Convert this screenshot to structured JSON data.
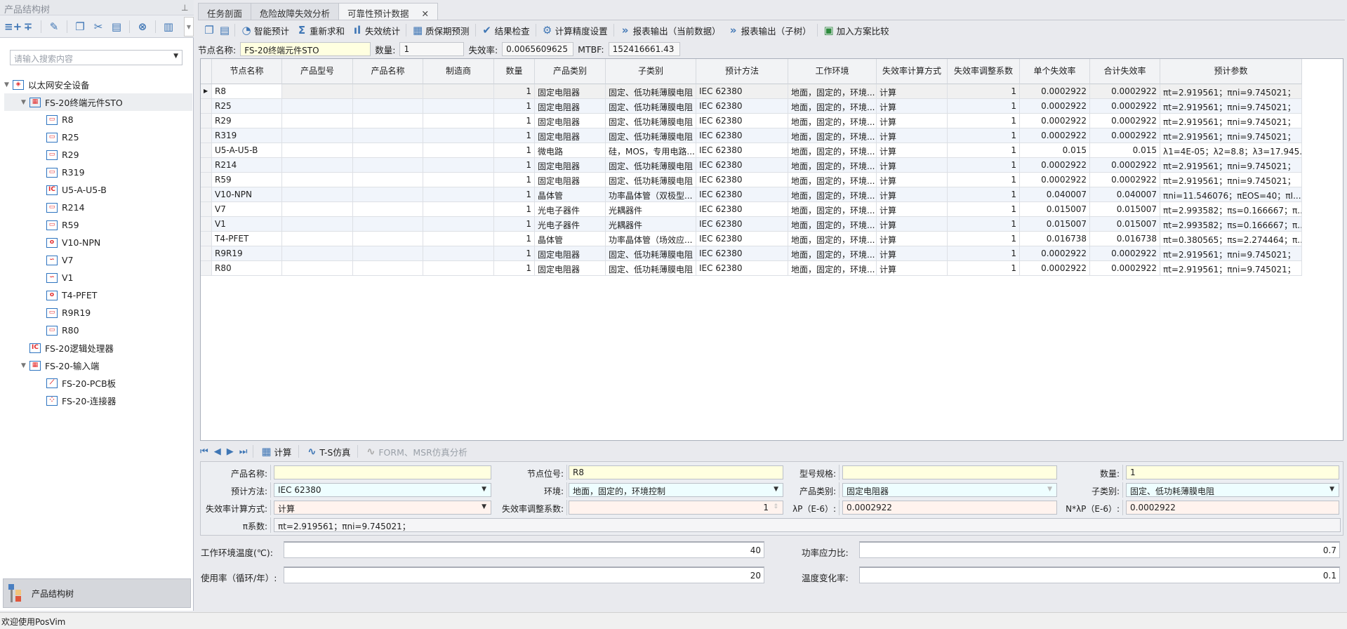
{
  "left_panel": {
    "title": "产品结构树",
    "search_placeholder": "请输入搜索内容",
    "bottom_button": "产品结构树",
    "toolbar_icons": [
      "add-child-icon",
      "add-sibling-icon",
      "edit-icon",
      "copy-icon",
      "cut-icon",
      "paste-icon",
      "delete-icon",
      "document-icon"
    ],
    "tree": [
      {
        "label": "以太网安全设备",
        "level": 0,
        "icon": "system-icon",
        "expanded": true
      },
      {
        "label": "FS-20终端元件STO",
        "level": 1,
        "icon": "assembly-icon",
        "expanded": true,
        "selected": true
      },
      {
        "label": "R8",
        "level": 2,
        "icon": "resistor-icon"
      },
      {
        "label": "R25",
        "level": 2,
        "icon": "resistor-icon"
      },
      {
        "label": "R29",
        "level": 2,
        "icon": "resistor-icon"
      },
      {
        "label": "R319",
        "level": 2,
        "icon": "resistor-icon"
      },
      {
        "label": "U5-A-U5-B",
        "level": 2,
        "icon": "ic-icon"
      },
      {
        "label": "R214",
        "level": 2,
        "icon": "resistor-icon"
      },
      {
        "label": "R59",
        "level": 2,
        "icon": "resistor-icon"
      },
      {
        "label": "V10-NPN",
        "level": 2,
        "icon": "transistor-icon"
      },
      {
        "label": "V7",
        "level": 2,
        "icon": "optocoupler-icon"
      },
      {
        "label": "V1",
        "level": 2,
        "icon": "optocoupler-icon"
      },
      {
        "label": "T4-PFET",
        "level": 2,
        "icon": "transistor-icon"
      },
      {
        "label": "R9R19",
        "level": 2,
        "icon": "resistor-icon"
      },
      {
        "label": "R80",
        "level": 2,
        "icon": "resistor-icon"
      },
      {
        "label": "FS-20逻辑处理器",
        "level": 1,
        "icon": "ic-icon"
      },
      {
        "label": "FS-20-输入端",
        "level": 1,
        "icon": "assembly-icon",
        "expanded": true
      },
      {
        "label": "FS-20-PCB板",
        "level": 2,
        "icon": "pcb-icon"
      },
      {
        "label": "FS-20-连接器",
        "level": 2,
        "icon": "connector-icon"
      }
    ]
  },
  "tabs": [
    {
      "label": "任务剖面"
    },
    {
      "label": "危险故障失效分析"
    },
    {
      "label": "可靠性预计数据",
      "active": true
    }
  ],
  "toolbar": [
    "智能预计",
    "重新求和",
    "失效统计",
    "质保期预测",
    "结果检查",
    "计算精度设置",
    "报表输出（当前数据）",
    "报表输出（子树）",
    "加入方案比较"
  ],
  "node": {
    "name_label": "节点名称:",
    "name": "FS-20终端元件STO",
    "qty_label": "数量:",
    "qty": "1",
    "rate_label": "失效率:",
    "rate": "0.0065609625",
    "mtbf_label": "MTBF:",
    "mtbf": "152416661.43"
  },
  "grid": {
    "columns": [
      "节点名称",
      "产品型号",
      "产品名称",
      "制造商",
      "数量",
      "产品类别",
      "子类别",
      "预计方法",
      "工作环境",
      "失效率计算方式",
      "失效率调整系数",
      "单个失效率",
      "合计失效率",
      "预计参数"
    ],
    "rows": [
      [
        "R8",
        "",
        "",
        "",
        "1",
        "固定电阻器",
        "固定、低功耗薄膜电阻",
        "IEC 62380",
        "地面，固定的，环境...",
        "计算",
        "1",
        "0.0002922",
        "0.0002922",
        "πt=2.919561；πni=9.745021；"
      ],
      [
        "R25",
        "",
        "",
        "",
        "1",
        "固定电阻器",
        "固定、低功耗薄膜电阻",
        "IEC 62380",
        "地面，固定的，环境...",
        "计算",
        "1",
        "0.0002922",
        "0.0002922",
        "πt=2.919561；πni=9.745021；"
      ],
      [
        "R29",
        "",
        "",
        "",
        "1",
        "固定电阻器",
        "固定、低功耗薄膜电阻",
        "IEC 62380",
        "地面，固定的，环境...",
        "计算",
        "1",
        "0.0002922",
        "0.0002922",
        "πt=2.919561；πni=9.745021；"
      ],
      [
        "R319",
        "",
        "",
        "",
        "1",
        "固定电阻器",
        "固定、低功耗薄膜电阻",
        "IEC 62380",
        "地面，固定的，环境...",
        "计算",
        "1",
        "0.0002922",
        "0.0002922",
        "πt=2.919561；πni=9.745021；"
      ],
      [
        "U5-A-U5-B",
        "",
        "",
        "",
        "1",
        "微电路",
        "硅，MOS，专用电路...",
        "IEC 62380",
        "地面，固定的，环境...",
        "计算",
        "1",
        "0.015",
        "0.015",
        "λ1=4E-05；λ2=8.8；λ3=17.945..."
      ],
      [
        "R214",
        "",
        "",
        "",
        "1",
        "固定电阻器",
        "固定、低功耗薄膜电阻",
        "IEC 62380",
        "地面，固定的，环境...",
        "计算",
        "1",
        "0.0002922",
        "0.0002922",
        "πt=2.919561；πni=9.745021；"
      ],
      [
        "R59",
        "",
        "",
        "",
        "1",
        "固定电阻器",
        "固定、低功耗薄膜电阻",
        "IEC 62380",
        "地面，固定的，环境...",
        "计算",
        "1",
        "0.0002922",
        "0.0002922",
        "πt=2.919561；πni=9.745021；"
      ],
      [
        "V10-NPN",
        "",
        "",
        "",
        "1",
        "晶体管",
        "功率晶体管（双极型...",
        "IEC 62380",
        "地面，固定的，环境...",
        "计算",
        "1",
        "0.040007",
        "0.040007",
        "πni=11.546076；πEOS=40；πI..."
      ],
      [
        "V7",
        "",
        "",
        "",
        "1",
        "光电子器件",
        "光耦器件",
        "IEC 62380",
        "地面，固定的，环境...",
        "计算",
        "1",
        "0.015007",
        "0.015007",
        "πt=2.993582；πs=0.166667；π..."
      ],
      [
        "V1",
        "",
        "",
        "",
        "1",
        "光电子器件",
        "光耦器件",
        "IEC 62380",
        "地面，固定的，环境...",
        "计算",
        "1",
        "0.015007",
        "0.015007",
        "πt=2.993582；πs=0.166667；π..."
      ],
      [
        "T4-PFET",
        "",
        "",
        "",
        "1",
        "晶体管",
        "功率晶体管（场效应...",
        "IEC 62380",
        "地面，固定的，环境...",
        "计算",
        "1",
        "0.016738",
        "0.016738",
        "πt=0.380565；πs=2.274464；π..."
      ],
      [
        "R9R19",
        "",
        "",
        "",
        "1",
        "固定电阻器",
        "固定、低功耗薄膜电阻",
        "IEC 62380",
        "地面，固定的，环境...",
        "计算",
        "1",
        "0.0002922",
        "0.0002922",
        "πt=2.919561；πni=9.745021；"
      ],
      [
        "R80",
        "",
        "",
        "",
        "1",
        "固定电阻器",
        "固定、低功耗薄膜电阻",
        "IEC 62380",
        "地面，固定的，环境...",
        "计算",
        "1",
        "0.0002922",
        "0.0002922",
        "πt=2.919561；πni=9.745021；"
      ]
    ]
  },
  "nav_toolbar": {
    "calc": "计算",
    "ts": "T-S仿真",
    "form": "FORM、MSR仿真分析"
  },
  "form": {
    "product_name_label": "产品名称:",
    "product_name": "",
    "node_pos_label": "节点位号:",
    "node_pos": "R8",
    "model_label": "型号规格:",
    "model": "",
    "qty_label": "数量:",
    "qty": "1",
    "method_label": "预计方法:",
    "method": "IEC 62380",
    "env_label": "环境:",
    "env": "地面，固定的，环境控制",
    "category_label": "产品类别:",
    "category": "固定电阻器",
    "subcat_label": "子类别:",
    "subcat": "固定、低功耗薄膜电阻",
    "calc_mode_label": "失效率计算方式:",
    "calc_mode": "计算",
    "adj_label": "失效率调整系数:",
    "adj": "1",
    "lp_label": "λP（E-6）:",
    "lp": "0.0002922",
    "nlp_label": "N*λP（E-6）:",
    "nlp": "0.0002922",
    "pi_label": "π系数:",
    "pi": "πt=2.919561；πni=9.745021；"
  },
  "params": {
    "temp_label": "工作环境温度(℃):",
    "temp": "40",
    "stress_label": "功率应力比:",
    "stress": "0.7",
    "usage_label": "使用率（循环/年）:",
    "usage": "20",
    "tvar_label": "温度变化率:",
    "tvar": "0.1"
  },
  "status": "欢迎使用PosVim"
}
